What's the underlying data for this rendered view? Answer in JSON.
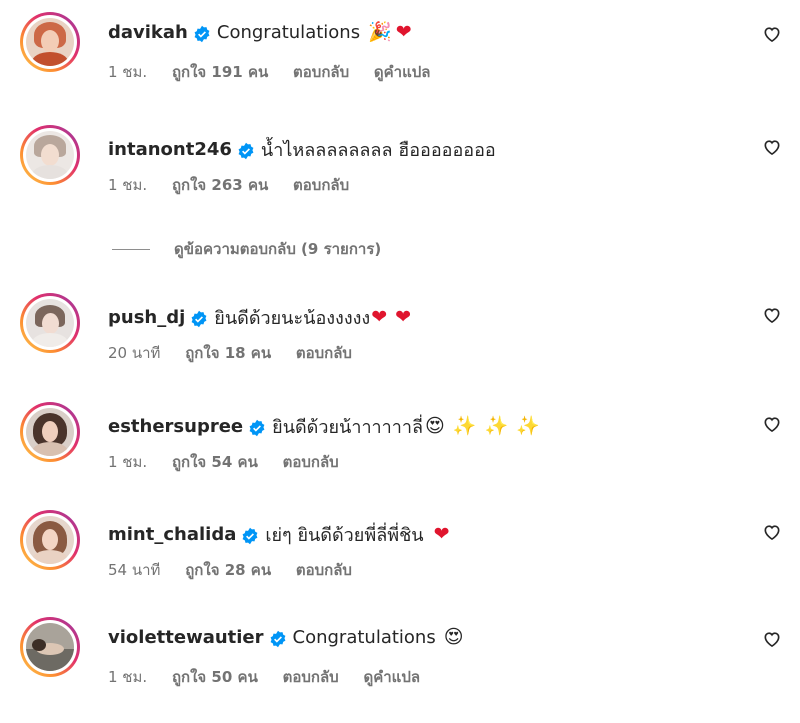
{
  "comments": [
    {
      "username": "davikah",
      "verified": true,
      "text": "Congratulations",
      "emojis": [
        "🎉",
        "❤"
      ],
      "time": "1 ชม.",
      "likes": "ถูกใจ 191 คน",
      "reply": "ตอบกลับ",
      "translate": "ดูคำแปล"
    },
    {
      "username": "intanont246",
      "verified": true,
      "text": "น้ำไหลลลลลลลล ฮืออออออออ",
      "emojis": [],
      "time": "1 ชม.",
      "likes": "ถูกใจ 263 คน",
      "reply": "ตอบกลับ",
      "translate": ""
    },
    {
      "username": "push_dj",
      "verified": true,
      "text": "ยินดีด้วยนะน้องงงงง",
      "emojis": [
        "❤",
        "❤"
      ],
      "time": "20 นาที",
      "likes": "ถูกใจ 18 คน",
      "reply": "ตอบกลับ",
      "translate": ""
    },
    {
      "username": "esthersupree",
      "verified": true,
      "text": "ยินดีด้วยน้าาาาาาลี่",
      "emojis": [
        "😍",
        "✨",
        "✨",
        "✨"
      ],
      "time": "1 ชม.",
      "likes": "ถูกใจ 54 คน",
      "reply": "ตอบกลับ",
      "translate": ""
    },
    {
      "username": "mint_chalida",
      "verified": true,
      "text": "เย่ๆ ยินดีด้วยพี่ลี่พี่ชิน",
      "emojis": [
        "❤"
      ],
      "time": "54 นาที",
      "likes": "ถูกใจ 28 คน",
      "reply": "ตอบกลับ",
      "translate": ""
    },
    {
      "username": "violettewautier",
      "verified": true,
      "text": "Congratulations",
      "emojis": [
        "😍"
      ],
      "time": "1 ชม.",
      "likes": "ถูกใจ 50 คน",
      "reply": "ตอบกลับ",
      "translate": "ดูคำแปล"
    }
  ],
  "view_replies": "ดูข้อความตอบกลับ (9 รายการ)",
  "colors": {
    "verified": "#0095f6",
    "heart": "#e0152e",
    "meta": "#737373",
    "text": "#262626"
  },
  "icons": {
    "like": "heart-outline-icon",
    "verified": "verified-badge-icon"
  }
}
